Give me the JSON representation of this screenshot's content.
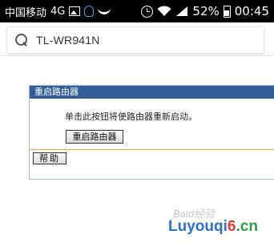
{
  "status_bar": {
    "carrier": "中国移动",
    "network": "4G",
    "battery_percent": "52%",
    "time": "00:45",
    "icons": [
      "image-icon",
      "qq-icon",
      "boat-icon",
      "alarm-icon",
      "wifi-icon",
      "signal-icon",
      "battery-icon"
    ]
  },
  "search_bar": {
    "value": "TL-WR941N",
    "icon": "search-icon"
  },
  "panel": {
    "title": "重启路由器",
    "description": "单击此按钮将使路由器重新启动。",
    "reboot_button_label": "重启路由器",
    "help_button_label": "帮助"
  },
  "watermark": {
    "baidu_text": "Baid经验",
    "site_part1": "Luyouqi",
    "site_part2": "6",
    "site_part3": ".cn"
  },
  "colors": {
    "panel_header_bg": "#335c98",
    "panel_border": "#9fb9d9",
    "divider": "#f0a94b",
    "status_bar_bg": "#000000"
  }
}
